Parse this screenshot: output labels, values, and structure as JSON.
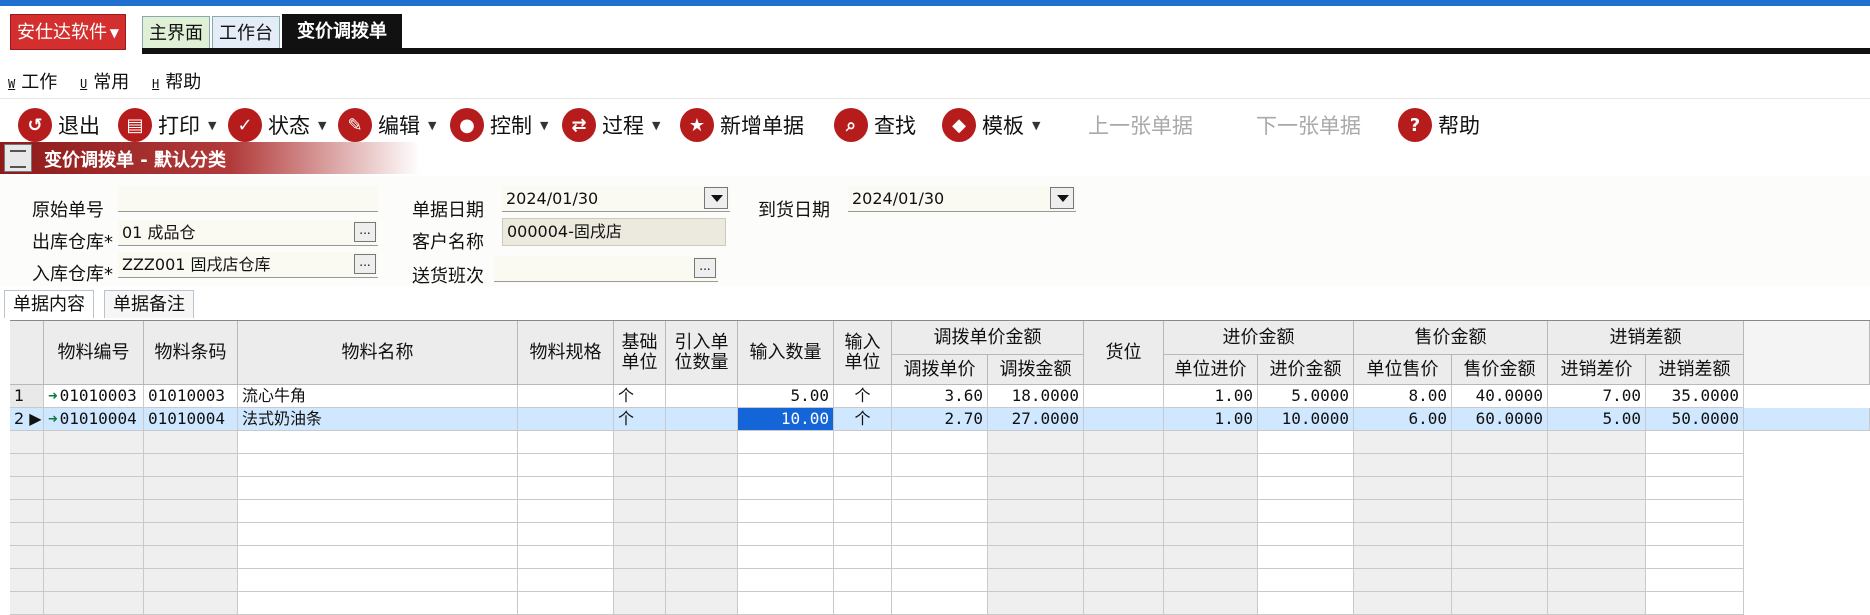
{
  "app": {
    "name": "安仕达软件"
  },
  "tabs": [
    {
      "label": "主界面"
    },
    {
      "label": "工作台"
    },
    {
      "label": "变价调拨单"
    }
  ],
  "menu": [
    {
      "key": "W",
      "label": "工作"
    },
    {
      "key": "U",
      "label": "常用"
    },
    {
      "key": "H",
      "label": "帮助"
    }
  ],
  "toolbar": {
    "exit": "退出",
    "print": "打印",
    "status": "状态",
    "edit": "编辑",
    "control": "控制",
    "process": "过程",
    "new_doc": "新增单据",
    "find": "查找",
    "template": "模板",
    "prev": "上一张单据",
    "next": "下一张单据",
    "help": "帮助"
  },
  "doc_title": "变价调拨单 - 默认分类",
  "form": {
    "original_no_label": "原始单号",
    "original_no": "",
    "out_wh_label": "出库仓库*",
    "out_wh": "01 成品仓",
    "in_wh_label": "入库仓库*",
    "in_wh": "ZZZ001 固戌店仓库",
    "doc_date_label": "单据日期",
    "doc_date": "2024/01/30",
    "customer_label": "客户名称",
    "customer": "000004-固戌店",
    "shift_label": "送货班次",
    "shift": "",
    "arrive_label": "到货日期",
    "arrive_date": "2024/01/30"
  },
  "subtabs": [
    {
      "label": "单据内容"
    },
    {
      "label": "单据备注"
    }
  ],
  "grid": {
    "headers": {
      "code": "物料编号",
      "barcode": "物料条码",
      "name": "物料名称",
      "spec": "物料规格",
      "base_unit": "基础单位",
      "import_qty": "引入单位数量",
      "input_qty": "输入数量",
      "input_unit": "输入单位",
      "transfer_group": "调拨单价金额",
      "transfer_price": "调拨单价",
      "transfer_amount": "调拨金额",
      "location": "货位",
      "cost_group": "进价金额",
      "unit_cost": "单位进价",
      "cost_amount": "进价金额",
      "sale_group": "售价金额",
      "unit_sale": "单位售价",
      "sale_amount": "售价金额",
      "margin_group": "进销差额",
      "margin_price": "进销差价",
      "margin_amount": "进销差额"
    },
    "rows": [
      {
        "no": "1",
        "code": "01010003",
        "barcode": "01010003",
        "name": "流心牛角",
        "spec": "",
        "base_unit": "个",
        "import_qty": "",
        "input_qty": "5.00",
        "input_unit": "个",
        "transfer_price": "3.60",
        "transfer_amount": "18.0000",
        "location": "",
        "unit_cost": "1.00",
        "cost_amount": "5.0000",
        "unit_sale": "8.00",
        "sale_amount": "40.0000",
        "margin_price": "7.00",
        "margin_amount": "35.0000"
      },
      {
        "no": "2",
        "code": "01010004",
        "barcode": "01010004",
        "name": "法式奶油条",
        "spec": "",
        "base_unit": "个",
        "import_qty": "",
        "input_qty": "10.00",
        "input_unit": "个",
        "transfer_price": "2.70",
        "transfer_amount": "27.0000",
        "location": "",
        "unit_cost": "1.00",
        "cost_amount": "10.0000",
        "unit_sale": "6.00",
        "sale_amount": "60.0000",
        "margin_price": "5.00",
        "margin_amount": "50.0000"
      }
    ]
  }
}
